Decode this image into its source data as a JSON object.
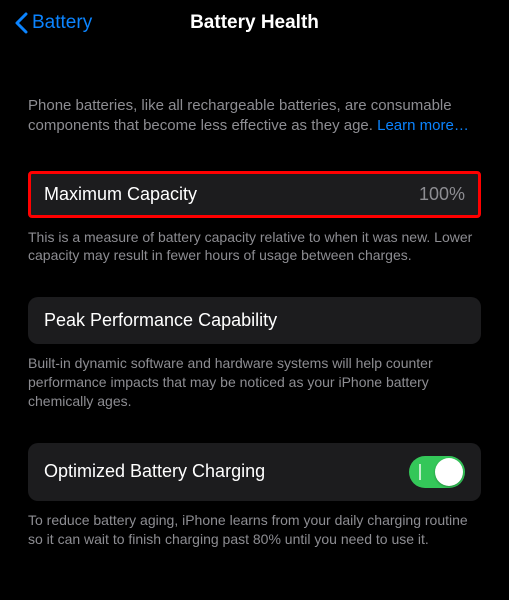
{
  "header": {
    "back_label": "Battery",
    "title": "Battery Health"
  },
  "intro": {
    "text": "Phone batteries, like all rechargeable batteries, are consumable components that become less effective as they age. ",
    "learn_more": "Learn more…"
  },
  "max_capacity": {
    "label": "Maximum Capacity",
    "value": "100%",
    "caption": "This is a measure of battery capacity relative to when it was new. Lower capacity may result in fewer hours of usage between charges."
  },
  "peak_performance": {
    "label": "Peak Performance Capability",
    "caption": "Built-in dynamic software and hardware systems will help counter performance impacts that may be noticed as your iPhone battery chemically ages."
  },
  "optimized_charging": {
    "label": "Optimized Battery Charging",
    "enabled": true,
    "caption": "To reduce battery aging, iPhone learns from your daily charging routine so it can wait to finish charging past 80% until you need to use it."
  }
}
